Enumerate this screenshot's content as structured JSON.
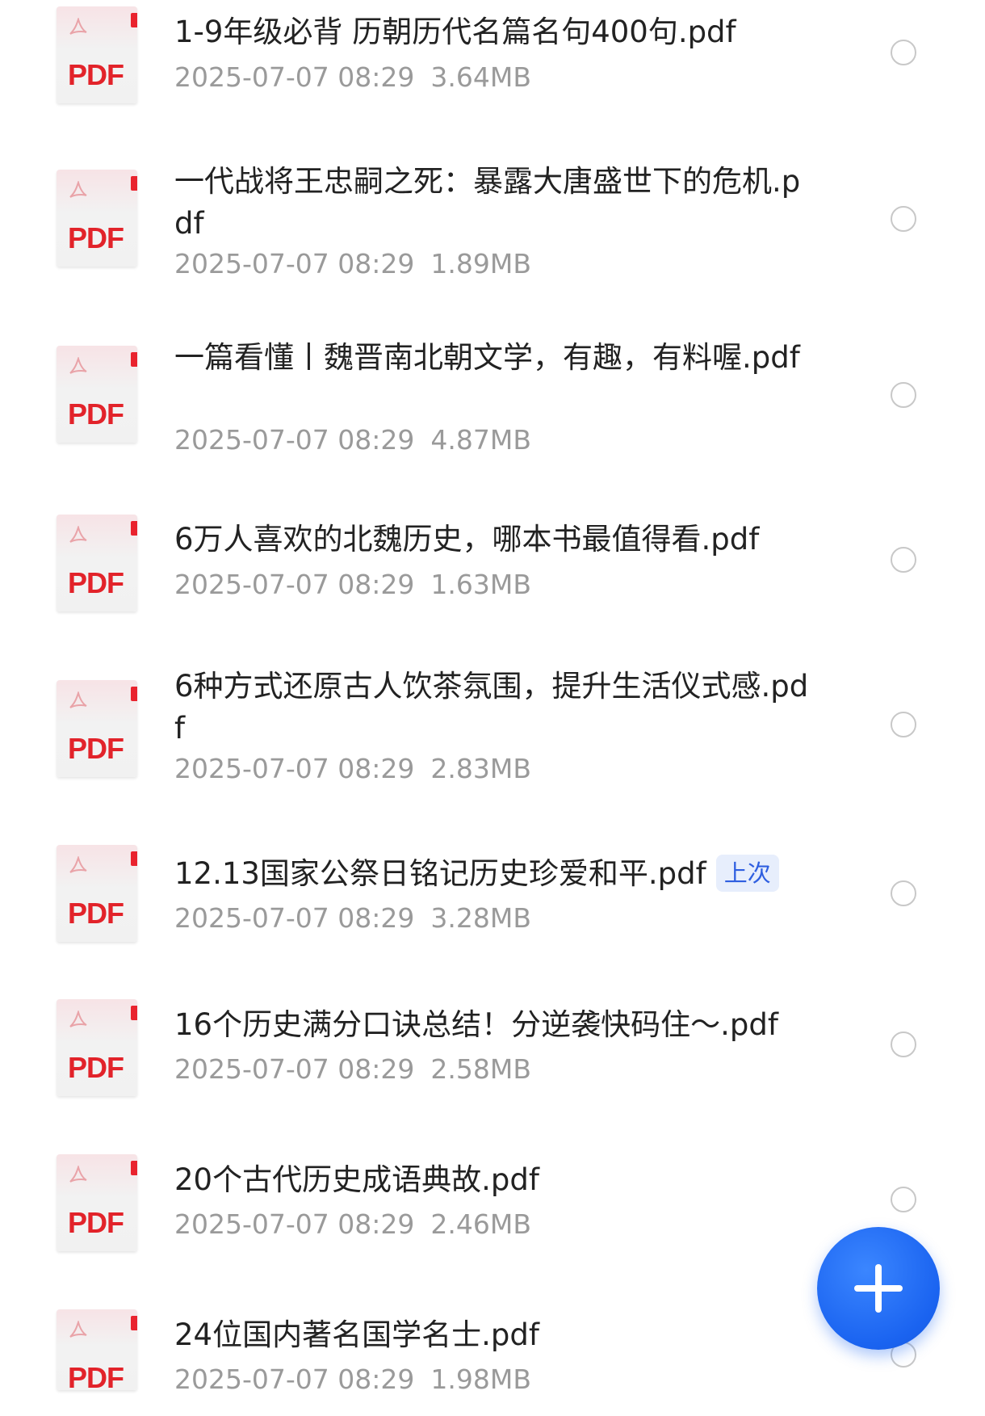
{
  "file_icon_label": "PDF",
  "colors": {
    "pdf_red": "#e2232a",
    "accent_blue": "#1a63f0",
    "meta_gray": "#9a9a9a"
  },
  "files": [
    {
      "name": "1-9年级必背 历朝历代名篇名句400句.pdf",
      "date": "2025-07-07 08:29",
      "size": "3.64MB",
      "tag": "",
      "selected": false
    },
    {
      "name": "一代战将王忠嗣之死：暴露大唐盛世下的危机.pdf",
      "date": "2025-07-07 08:29",
      "size": "1.89MB",
      "tag": "",
      "selected": false
    },
    {
      "name": "一篇看懂丨魏晋南北朝文学，有趣，有料喔.pdf",
      "date": "2025-07-07 08:29",
      "size": "4.87MB",
      "tag": "",
      "selected": false
    },
    {
      "name": "6万人喜欢的北魏历史，哪本书最值得看.pdf",
      "date": "2025-07-07 08:29",
      "size": "1.63MB",
      "tag": "",
      "selected": false
    },
    {
      "name": "6种方式还原古人饮茶氛围，提升生活仪式感.pdf",
      "date": "2025-07-07 08:29",
      "size": "2.83MB",
      "tag": "",
      "selected": false
    },
    {
      "name": "12.13国家公祭日铭记历史珍爱和平.pdf",
      "date": "2025-07-07 08:29",
      "size": "3.28MB",
      "tag": "上次",
      "selected": false
    },
    {
      "name": "16个历史满分口诀总结！分逆袭快码住～.pdf",
      "date": "2025-07-07 08:29",
      "size": "2.58MB",
      "tag": "",
      "selected": false
    },
    {
      "name": "20个古代历史成语典故.pdf",
      "date": "2025-07-07 08:29",
      "size": "2.46MB",
      "tag": "",
      "selected": false
    },
    {
      "name": "24位国内著名国学名士.pdf",
      "date": "2025-07-07 08:29",
      "size": "1.98MB",
      "tag": "",
      "selected": false
    }
  ],
  "fab": {
    "icon": "plus-icon"
  }
}
